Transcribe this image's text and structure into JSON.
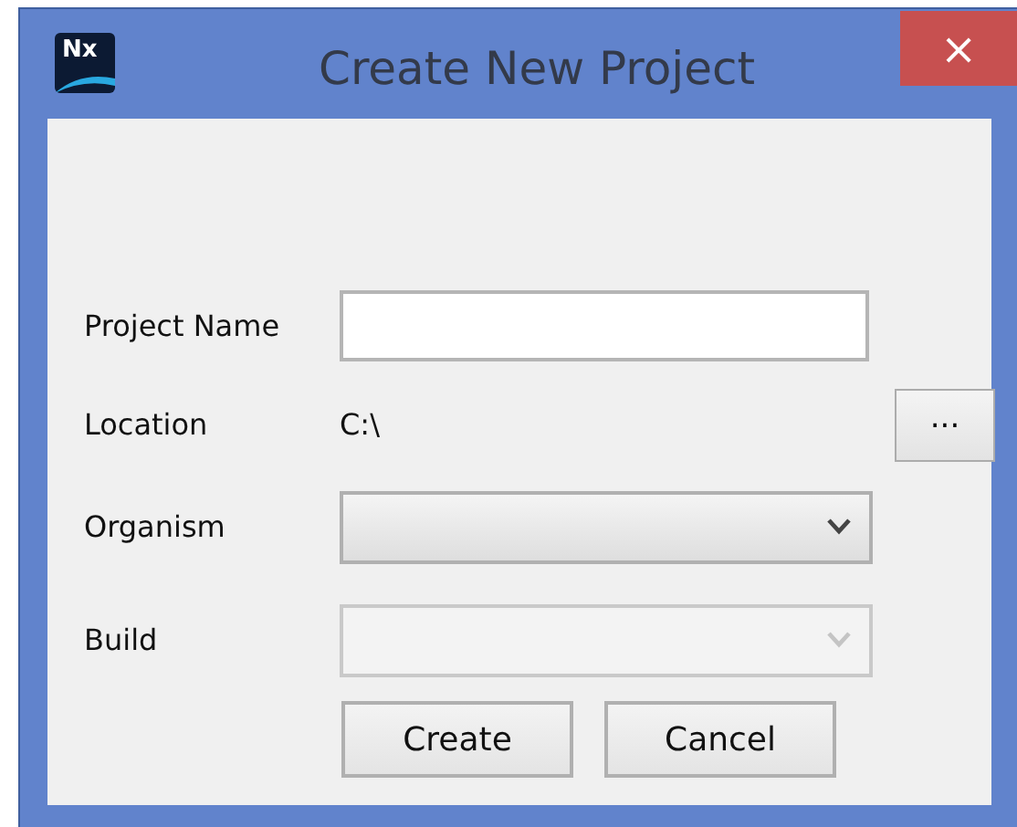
{
  "window": {
    "title": "Create New Project",
    "logo": "Nx",
    "close": "×"
  },
  "fields": [
    {
      "kind": "text",
      "label": "Project Name"
    },
    {
      "kind": "path",
      "label": "Location",
      "value": "C:\\",
      "browse": "..."
    },
    {
      "kind": "select",
      "label": "Organism",
      "disabled": false
    },
    {
      "kind": "select",
      "label": "Build",
      "disabled": true
    }
  ],
  "buttons": [
    "Create",
    "Cancel"
  ]
}
